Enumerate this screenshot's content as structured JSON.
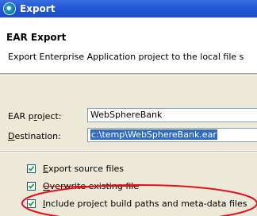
{
  "window": {
    "title": "Export"
  },
  "header": {
    "title": "EAR Export",
    "description": "Export Enterprise Application project to the local file s"
  },
  "form": {
    "ear_project": {
      "label_underlined": "r",
      "label_before": "EAR p",
      "label_after": "oject:",
      "value": "WebSphereBank"
    },
    "destination": {
      "label_underlined": "D",
      "label_after": "estination:",
      "value": "c:\\temp\\WebSphereBank.ear"
    }
  },
  "options": [
    {
      "label_underlined": "E",
      "label_rest": "xport source files",
      "checked": true
    },
    {
      "label_underlined": "O",
      "label_rest": "verwrite existing file",
      "checked": true
    },
    {
      "label_underlined": "I",
      "label_rest": "nclude project build paths and meta-data files",
      "checked": true
    }
  ],
  "annotation": {
    "highlight_color": "#e01020"
  }
}
